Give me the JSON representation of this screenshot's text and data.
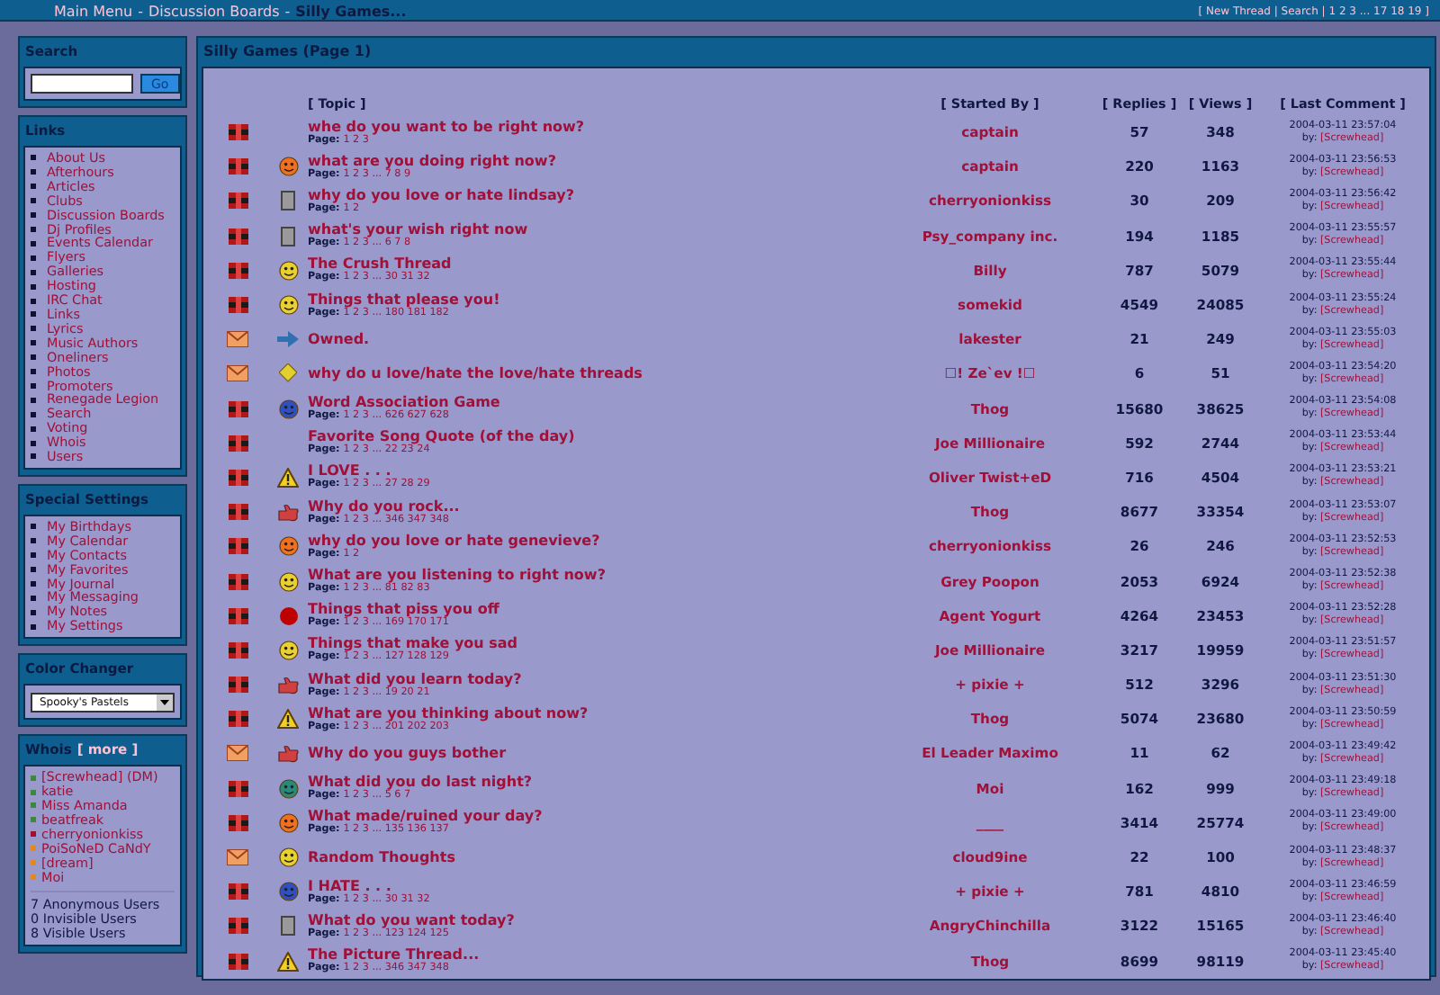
{
  "breadcrumb": [
    {
      "kind": "link",
      "label": "Main Menu"
    },
    {
      "kind": "sep",
      "label": "-"
    },
    {
      "kind": "link",
      "label": "Discussion Boards"
    },
    {
      "kind": "sep",
      "label": "-"
    },
    {
      "kind": "current",
      "label": "Silly Games..."
    }
  ],
  "top_links": "[ New Thread | Search | 1 2 3 ... 17 18 19 ]",
  "search": {
    "title": "Search",
    "button": "Go"
  },
  "links": {
    "title": "Links",
    "items": [
      "About Us",
      "Afterhours",
      "Articles",
      "Clubs",
      "Discussion Boards",
      "Dj Profiles",
      "Events Calendar",
      "Flyers",
      "Galleries",
      "Hosting",
      "IRC Chat",
      "Links",
      "Lyrics",
      "Music Authors",
      "Oneliners",
      "Photos",
      "Promoters",
      "Renegade Legion",
      "Search",
      "Voting",
      "Whois",
      "Users"
    ]
  },
  "special_settings": {
    "title": "Special Settings",
    "items": [
      "My Birthdays",
      "My Calendar",
      "My Contacts",
      "My Favorites",
      "My Journal",
      "My Messaging",
      "My Notes",
      "My Settings"
    ]
  },
  "color_changer": {
    "title": "Color Changer",
    "value": "Spooky's Pastels"
  },
  "whois": {
    "title": "Whois",
    "more": "[ more ]",
    "users": [
      {
        "name": "[Screwhead] (DM)",
        "color": "#3a8a3a"
      },
      {
        "name": "katie",
        "color": "#3a8a3a"
      },
      {
        "name": "Miss Amanda",
        "color": "#3a8a3a"
      },
      {
        "name": "beatfreak",
        "color": "#3a8a3a"
      },
      {
        "name": "cherryonionkiss",
        "color": "#a01030"
      },
      {
        "name": "PoiSoNeD CaNdY",
        "color": "#e08a20"
      },
      {
        "name": "[dream]",
        "color": "#e08a20"
      },
      {
        "name": "Moi",
        "color": "#e08a20"
      }
    ],
    "counts": [
      "7 Anonymous Users",
      "0 Invisible Users",
      "8 Visible Users"
    ]
  },
  "board": {
    "title": "Silly Games (Page 1)",
    "columns": [
      "[ Topic ]",
      "[ Started By ]",
      "[ Replies ]",
      "[ Views ]",
      "[ Last Comment ]"
    ],
    "rows": [
      {
        "kind": "hot",
        "title": "whe do you want to be right now?",
        "pages_label": "Page:",
        "pages": "1 2 3",
        "starter": "captain",
        "replies": "57",
        "views": "348",
        "last_date": "2004-03-11 23:57:04",
        "by_label": "by:",
        "last_by": "[Screwhead]"
      },
      {
        "kind": "hot",
        "title": "what are you doing right now?",
        "pages_label": "Page:",
        "pages": "1 2 3 ... 7 8 9",
        "starter": "captain",
        "replies": "220",
        "views": "1163",
        "last_date": "2004-03-11 23:56:53",
        "by_label": "by:",
        "last_by": "[Screwhead]"
      },
      {
        "kind": "hot",
        "title": "why do you love or hate lindsay?",
        "pages_label": "Page:",
        "pages": "1 2",
        "starter": "cherryonionkiss",
        "replies": "30",
        "views": "209",
        "last_date": "2004-03-11 23:56:42",
        "by_label": "by:",
        "last_by": "[Screwhead]"
      },
      {
        "kind": "hot",
        "title": "what's your wish right now",
        "pages_label": "Page:",
        "pages": "1 2 3 ... 6 7 8",
        "starter": "Psy_company inc.",
        "replies": "194",
        "views": "1185",
        "last_date": "2004-03-11 23:55:57",
        "by_label": "by:",
        "last_by": "[Screwhead]"
      },
      {
        "kind": "hot",
        "title": "The Crush Thread",
        "pages_label": "Page:",
        "pages": "1 2 3 ... 30 31 32",
        "starter": "Billy",
        "replies": "787",
        "views": "5079",
        "last_date": "2004-03-11 23:55:44",
        "by_label": "by:",
        "last_by": "[Screwhead]"
      },
      {
        "kind": "hot",
        "title": "Things that please you!",
        "pages_label": "Page:",
        "pages": "1 2 3 ... 180 181 182",
        "starter": "somekid",
        "replies": "4549",
        "views": "24085",
        "last_date": "2004-03-11 23:55:24",
        "by_label": "by:",
        "last_by": "[Screwhead]"
      },
      {
        "kind": "new",
        "title": "Owned.",
        "starter": "lakester",
        "replies": "21",
        "views": "249",
        "last_date": "2004-03-11 23:55:03",
        "by_label": "by:",
        "last_by": "[Screwhead]"
      },
      {
        "kind": "new",
        "title": "why do u love/hate the love/hate threads",
        "starter": "☐! Ze`ev !☐",
        "replies": "6",
        "views": "51",
        "last_date": "2004-03-11 23:54:20",
        "by_label": "by:",
        "last_by": "[Screwhead]"
      },
      {
        "kind": "hot",
        "title": "Word Association Game",
        "pages_label": "Page:",
        "pages": "1 2 3 ... 626 627 628",
        "starter": "Thog",
        "replies": "15680",
        "views": "38625",
        "last_date": "2004-03-11 23:54:08",
        "by_label": "by:",
        "last_by": "[Screwhead]"
      },
      {
        "kind": "hot",
        "title": "Favorite Song Quote (of the day)",
        "pages_label": "Page:",
        "pages": "1 2 3 ... 22 23 24",
        "starter": "Joe Millionaire",
        "replies": "592",
        "views": "2744",
        "last_date": "2004-03-11 23:53:44",
        "by_label": "by:",
        "last_by": "[Screwhead]"
      },
      {
        "kind": "hot",
        "title": "I LOVE . . .",
        "pages_label": "Page:",
        "pages": "1 2 3 ... 27 28 29",
        "starter": "Oliver Twist+eD",
        "replies": "716",
        "views": "4504",
        "last_date": "2004-03-11 23:53:21",
        "by_label": "by:",
        "last_by": "[Screwhead]"
      },
      {
        "kind": "hot",
        "title": "Why do you rock...",
        "pages_label": "Page:",
        "pages": "1 2 3 ... 346 347 348",
        "starter": "Thog",
        "replies": "8677",
        "views": "33354",
        "last_date": "2004-03-11 23:53:07",
        "by_label": "by:",
        "last_by": "[Screwhead]"
      },
      {
        "kind": "hot",
        "title": "why do you love or hate genevieve?",
        "pages_label": "Page:",
        "pages": "1 2",
        "starter": "cherryonionkiss",
        "replies": "26",
        "views": "246",
        "last_date": "2004-03-11 23:52:53",
        "by_label": "by:",
        "last_by": "[Screwhead]"
      },
      {
        "kind": "hot",
        "title": "What are you listening to right now?",
        "pages_label": "Page:",
        "pages": "1 2 3 ... 81 82 83",
        "starter": "Grey Poopon",
        "replies": "2053",
        "views": "6924",
        "last_date": "2004-03-11 23:52:38",
        "by_label": "by:",
        "last_by": "[Screwhead]"
      },
      {
        "kind": "hot",
        "title": "Things that piss you off",
        "pages_label": "Page:",
        "pages": "1 2 3 ... 169 170 171",
        "starter": "Agent Yogurt",
        "replies": "4264",
        "views": "23453",
        "last_date": "2004-03-11 23:52:28",
        "by_label": "by:",
        "last_by": "[Screwhead]"
      },
      {
        "kind": "hot",
        "title": "Things that make you sad",
        "pages_label": "Page:",
        "pages": "1 2 3 ... 127 128 129",
        "starter": "Joe Millionaire",
        "replies": "3217",
        "views": "19959",
        "last_date": "2004-03-11 23:51:57",
        "by_label": "by:",
        "last_by": "[Screwhead]"
      },
      {
        "kind": "hot",
        "title": "What did you learn today?",
        "pages_label": "Page:",
        "pages": "1 2 3 ... 19 20 21",
        "starter": "+ pixie +",
        "replies": "512",
        "views": "3296",
        "last_date": "2004-03-11 23:51:30",
        "by_label": "by:",
        "last_by": "[Screwhead]"
      },
      {
        "kind": "hot",
        "title": "What are you thinking about now?",
        "pages_label": "Page:",
        "pages": "1 2 3 ... 201 202 203",
        "starter": "Thog",
        "replies": "5074",
        "views": "23680",
        "last_date": "2004-03-11 23:50:59",
        "by_label": "by:",
        "last_by": "[Screwhead]"
      },
      {
        "kind": "new",
        "title": "Why do you guys bother",
        "starter": "El Leader Maximo",
        "replies": "11",
        "views": "62",
        "last_date": "2004-03-11 23:49:42",
        "by_label": "by:",
        "last_by": "[Screwhead]"
      },
      {
        "kind": "hot",
        "title": "What did you do last night?",
        "pages_label": "Page:",
        "pages": "1 2 3 ... 5 6 7",
        "starter": "Moi",
        "replies": "162",
        "views": "999",
        "last_date": "2004-03-11 23:49:18",
        "by_label": "by:",
        "last_by": "[Screwhead]"
      },
      {
        "kind": "hot",
        "title": "What made/ruined your day?",
        "pages_label": "Page:",
        "pages": "1 2 3 ... 135 136 137",
        "starter": "____",
        "replies": "3414",
        "views": "25774",
        "last_date": "2004-03-11 23:49:00",
        "by_label": "by:",
        "last_by": "[Screwhead]"
      },
      {
        "kind": "new",
        "title": "Random Thoughts",
        "starter": "cloud9ine",
        "replies": "22",
        "views": "100",
        "last_date": "2004-03-11 23:48:37",
        "by_label": "by:",
        "last_by": "[Screwhead]"
      },
      {
        "kind": "hot",
        "title": "I HATE . . .",
        "pages_label": "Page:",
        "pages": "1 2 3 ... 30 31 32",
        "starter": "+ pixie +",
        "replies": "781",
        "views": "4810",
        "last_date": "2004-03-11 23:46:59",
        "by_label": "by:",
        "last_by": "[Screwhead]"
      },
      {
        "kind": "hot",
        "title": "What do you want today?",
        "pages_label": "Page:",
        "pages": "1 2 3 ... 123 124 125",
        "starter": "AngryChinchilla",
        "replies": "3122",
        "views": "15165",
        "last_date": "2004-03-11 23:46:40",
        "by_label": "by:",
        "last_by": "[Screwhead]"
      },
      {
        "kind": "hot",
        "title": "The Picture Thread...",
        "pages_label": "Page:",
        "pages": "1 2 3 ... 346 347 348",
        "starter": "Thog",
        "replies": "8699",
        "views": "98119",
        "last_date": "2004-03-11 23:45:40",
        "by_label": "by:",
        "last_by": "[Screwhead]"
      }
    ]
  }
}
